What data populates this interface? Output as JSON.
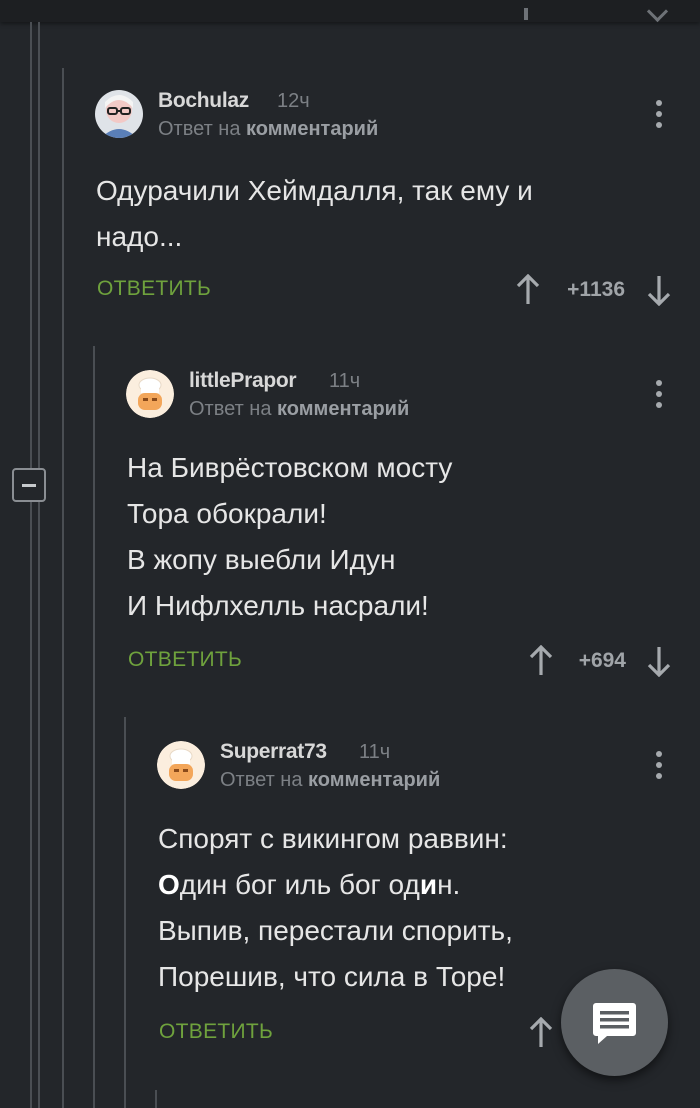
{
  "comments": [
    {
      "author": "Bochulaz",
      "time": "12ч",
      "reply_prefix": "Ответ на",
      "reply_target": "комментарий",
      "lines": [
        "Одурачили Хеймдалля, так ему и",
        "надо..."
      ],
      "reply_label": "ОТВЕТИТЬ",
      "score": "+1136",
      "avatar_icon": "user-photo-avatar"
    },
    {
      "author": "littlePrapor",
      "time": "11ч",
      "reply_prefix": "Ответ на",
      "reply_target": "комментарий",
      "lines": [
        "На Биврёстовском мосту",
        "Тора обокрали!",
        "В жопу выебли Идун",
        "И Нифлхелль насрали!"
      ],
      "reply_label": "ОТВЕТИТЬ",
      "score": "+694",
      "avatar_icon": "default-cook-avatar"
    },
    {
      "author": "Superrat73",
      "time": "11ч",
      "reply_prefix": "Ответ на",
      "reply_target": "комментарий",
      "lines": [
        "Спорят с викингом раввин:",
        "Один бог иль бог один.",
        "Выпив, перестали спорить,",
        "Порешив, что сила в Торе!"
      ],
      "line2_parts": [
        "О",
        "дин бог иль бог од",
        "и",
        "н."
      ],
      "reply_label": "ОТВЕТИТЬ",
      "avatar_icon": "default-cook-avatar"
    }
  ],
  "fab_icon": "comment-icon",
  "colors": {
    "background": "#23262a",
    "reply": "#6fa23d",
    "meta": "#7c8085"
  }
}
